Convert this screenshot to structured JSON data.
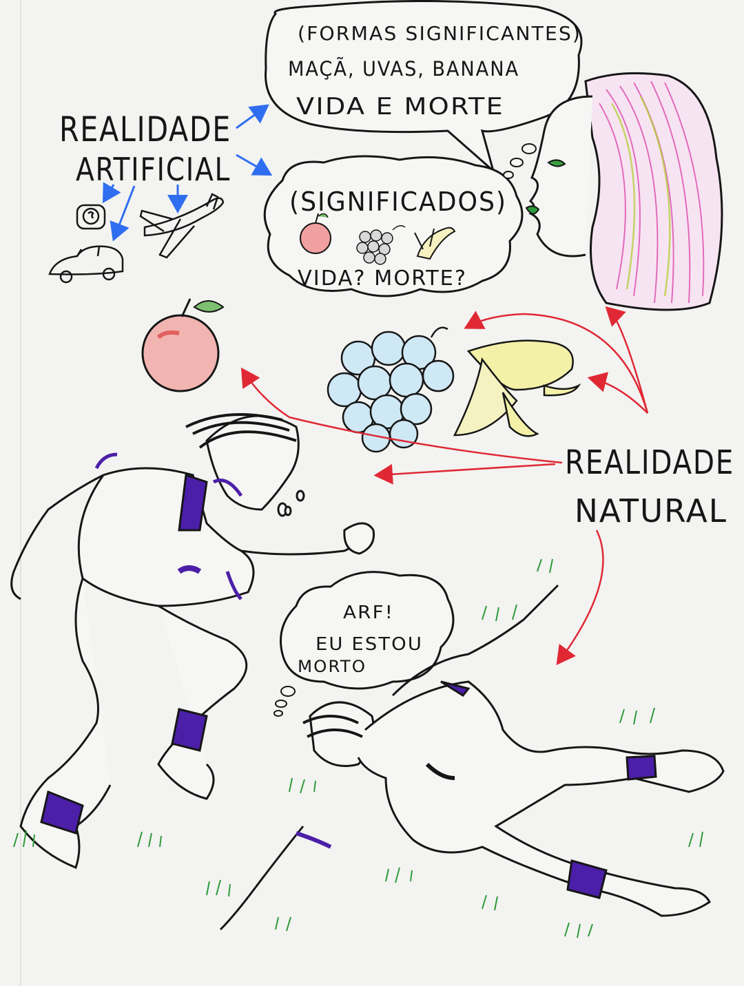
{
  "poster": {
    "realidade_artificial": [
      "REALIDADE",
      "ARTIFICIAL"
    ],
    "realidade_natural": [
      "REALIDADE",
      "NATURAL"
    ],
    "speech_bubble": {
      "line1": "(FORMAS SIGNIFICANTES)",
      "line2": "MAÇÃ, UVAS, BANANA",
      "line3": "VIDA E MORTE"
    },
    "thought_bubble": {
      "title": "(SIGNIFICADOS)",
      "question": "VIDA? MORTE?"
    },
    "runner_thought": {
      "line1": "ARF!",
      "line2": "EU ESTOU",
      "line3": "MORTO"
    },
    "colors": {
      "paper": "#f3f3f1",
      "ink": "#161616",
      "blue_arrow": "#2f6ef0",
      "red_arrow": "#e02835",
      "shirt_purple": "#4b1fa8",
      "grass_green": "#2e9a3a",
      "hair_pink": "#e05cb8",
      "apple_red": "#e88080",
      "grape_blue": "#bfe0f0",
      "banana_yellow": "#f3f0a8"
    },
    "icons": [
      "clock-icon",
      "car-icon",
      "airplane-icon",
      "apple-icon",
      "grapes-icon",
      "banana-icon",
      "woman-face-icon",
      "runner-icon",
      "fallen-runner-icon"
    ]
  }
}
